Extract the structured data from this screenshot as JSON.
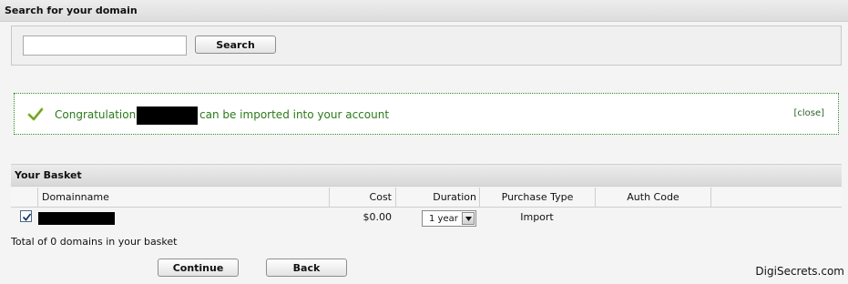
{
  "search": {
    "header": "Search for your domain",
    "input_value": "",
    "button_label": "Search"
  },
  "message": {
    "pre_text": "Congratulations!",
    "post_text": "can be imported into your account",
    "close_label": "[close]",
    "color": "#2a7a1a"
  },
  "basket": {
    "header": "Your Basket",
    "columns": [
      "Domainname",
      "Cost",
      "Duration",
      "Purchase Type",
      "Auth Code"
    ],
    "rows": [
      {
        "checked": true,
        "cost": "$0.00",
        "duration": "1 year",
        "purchase_type": "Import"
      }
    ],
    "total_text": "Total of 0 domains in your basket"
  },
  "actions": {
    "continue_label": "Continue",
    "back_label": "Back"
  },
  "watermark": "DigiSecrets.com"
}
